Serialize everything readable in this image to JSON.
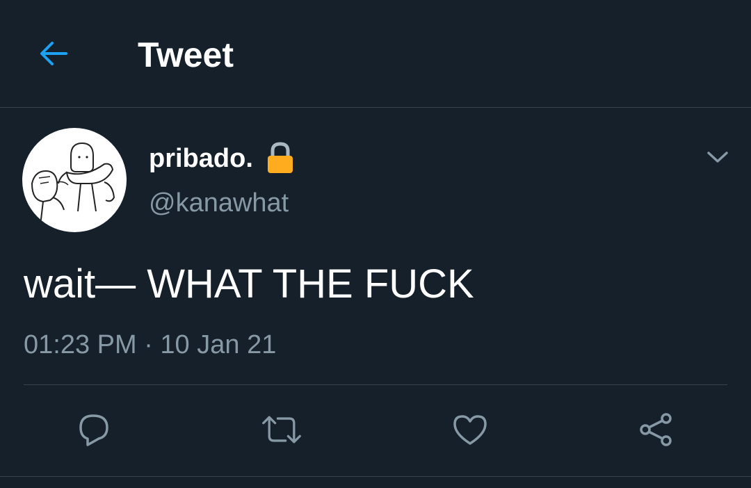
{
  "header": {
    "title": "Tweet",
    "back_icon": "back-arrow-icon"
  },
  "tweet": {
    "author": {
      "display_name": "pribado.",
      "handle": "@kanawhat",
      "protected_icon": "lock-icon"
    },
    "text": "wait— WHAT THE FUCK",
    "timestamp": "01:23 PM · 10 Jan 21",
    "actions": [
      {
        "name": "reply",
        "icon": "reply-icon"
      },
      {
        "name": "retweet",
        "icon": "retweet-icon"
      },
      {
        "name": "like",
        "icon": "heart-icon"
      },
      {
        "name": "share",
        "icon": "share-icon"
      }
    ]
  },
  "colors": {
    "background": "#15202b",
    "accent": "#1da1f2",
    "secondary_text": "#8899a6",
    "divider": "#38444d",
    "lock": "#ffad1f"
  }
}
